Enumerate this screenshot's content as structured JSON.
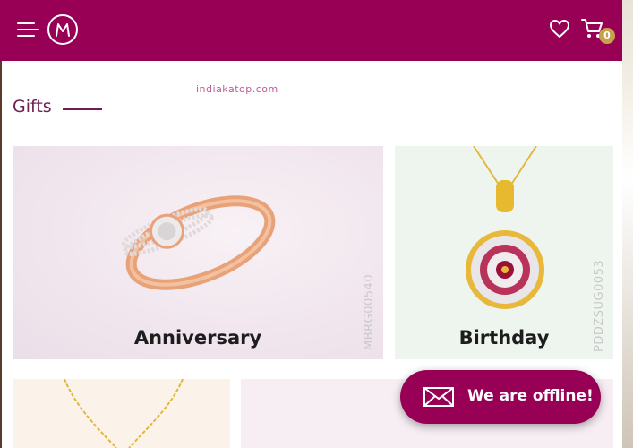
{
  "watermark": "indiakatop.com",
  "section": {
    "title": "Gifts"
  },
  "cart": {
    "count": "0"
  },
  "cards": [
    {
      "label": "Anniversary",
      "sku": "MBRG00540"
    },
    {
      "label": "Birthday",
      "sku": "PDDZSUG0053"
    }
  ],
  "chat": {
    "label": "We are offline!"
  },
  "colors": {
    "brand": "#980055",
    "badge": "#c8a24a",
    "title": "#6c1e55"
  },
  "icons": [
    "menu-icon",
    "brand-logo-icon",
    "heart-icon",
    "cart-icon",
    "mail-icon"
  ]
}
